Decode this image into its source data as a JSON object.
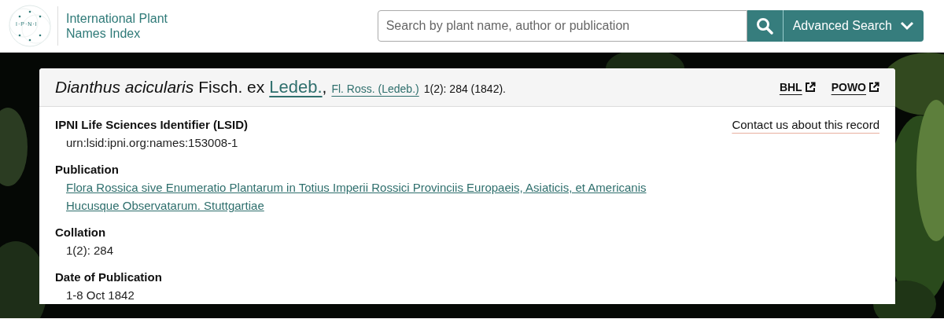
{
  "header": {
    "logo_text": "I·P·N·I",
    "site_name": [
      "International Plant",
      "Names Index"
    ],
    "search": {
      "placeholder": "Search by plant name, author or publication"
    },
    "advanced_search": "Advanced Search"
  },
  "record": {
    "name": "Dianthus acicularis",
    "author_prefix": "Fisch. ex",
    "author_link": "Ledeb.",
    "separator": ",",
    "publication_link": "Fl. Ross. (Ledeb.)",
    "citation": "1(2): 284 (1842).",
    "external_links": [
      "BHL",
      "POWO"
    ],
    "contact_link": "Contact us about this record",
    "fields": [
      {
        "label": "IPNI Life Sciences Identifier (LSID)",
        "kind": "text",
        "value": "urn:lsid:ipni.org:names:153008-1"
      },
      {
        "label": "Publication",
        "kind": "link",
        "value": "Flora Rossica sive Enumeratio Plantarum in Totius Imperii Rossici Provinciis Europaeis, Asiaticis, et Americanis Hucusque Observatarum. Stuttgartiae"
      },
      {
        "label": "Collation",
        "kind": "text",
        "value": "1(2): 284"
      },
      {
        "label": "Date of Publication",
        "kind": "text",
        "value": "1-8 Oct 1842"
      }
    ]
  }
}
